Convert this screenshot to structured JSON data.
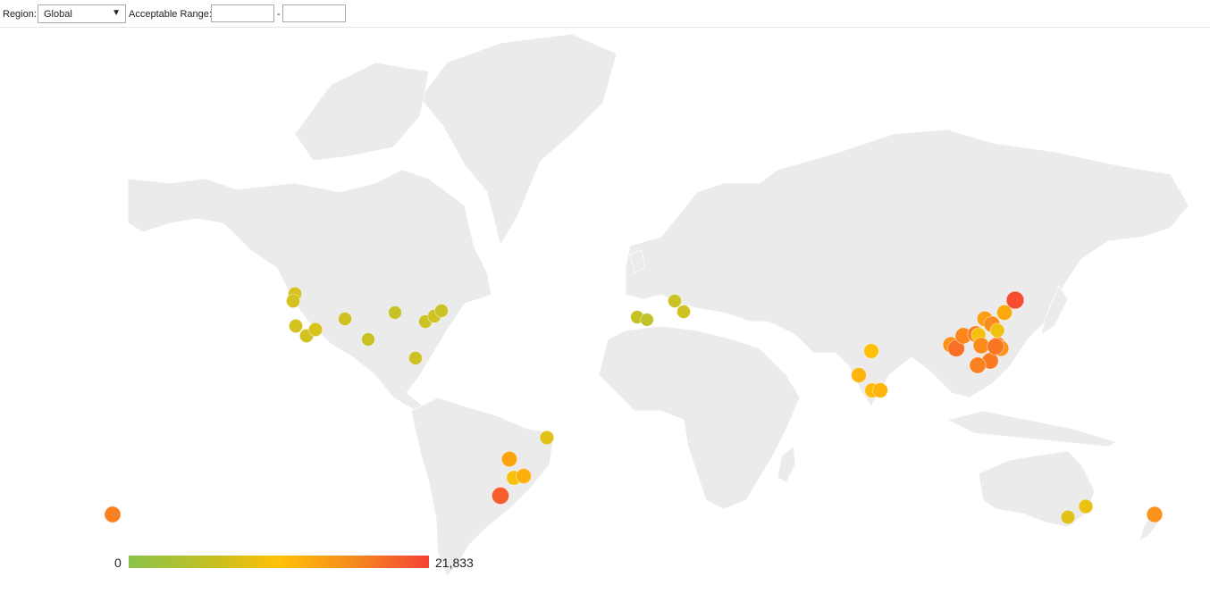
{
  "toolbar": {
    "region_label": "Region:",
    "region_value": "Global",
    "range_label": "Acceptable Range:",
    "range_separator": "-",
    "range_min": "",
    "range_max": ""
  },
  "legend": {
    "min_label": "0",
    "max_label": "21,833",
    "min": 0,
    "max": 21833,
    "colors": [
      "#8bc34a",
      "#ffc107",
      "#f44336"
    ]
  },
  "land_color": "#ebebeb",
  "border_color": "#ffffff",
  "markers": [
    {
      "region": "Hawaii",
      "value": 16500
    },
    {
      "region": "Seattle",
      "value": 7000
    },
    {
      "region": "Portland",
      "value": 6800
    },
    {
      "region": "San Francisco",
      "value": 6900
    },
    {
      "region": "Los Angeles",
      "value": 6600
    },
    {
      "region": "Arizona",
      "value": 7200
    },
    {
      "region": "Denver",
      "value": 6300
    },
    {
      "region": "Dallas",
      "value": 5800
    },
    {
      "region": "Chicago",
      "value": 5600
    },
    {
      "region": "Ashburn",
      "value": 6200
    },
    {
      "region": "New Jersey",
      "value": 6400
    },
    {
      "region": "New York",
      "value": 6000
    },
    {
      "region": "Miami",
      "value": 6100
    },
    {
      "region": "Brazil North",
      "value": 8000
    },
    {
      "region": "Brazil Central",
      "value": 13500
    },
    {
      "region": "Brazil West",
      "value": 10000
    },
    {
      "region": "Brazil South",
      "value": 12500
    },
    {
      "region": "Sao Paulo",
      "value": 19500
    },
    {
      "region": "Madrid",
      "value": 5500
    },
    {
      "region": "Barcelona",
      "value": 5000
    },
    {
      "region": "Frankfurt",
      "value": 6000
    },
    {
      "region": "Milan",
      "value": 6500
    },
    {
      "region": "Mumbai",
      "value": 12000
    },
    {
      "region": "Pune",
      "value": 11500
    },
    {
      "region": "Chennai",
      "value": 12000
    },
    {
      "region": "Hyderabad",
      "value": 11000
    },
    {
      "region": "China West",
      "value": 15000
    },
    {
      "region": "Chengdu",
      "value": 18000
    },
    {
      "region": "Chongqing",
      "value": 16000
    },
    {
      "region": "Xian",
      "value": 17000
    },
    {
      "region": "Beijing",
      "value": 14000
    },
    {
      "region": "Tianjin",
      "value": 15500
    },
    {
      "region": "Wuhan",
      "value": 10000
    },
    {
      "region": "Nanjing",
      "value": 16000
    },
    {
      "region": "Shanghai",
      "value": 15000
    },
    {
      "region": "Qingdao",
      "value": 9500
    },
    {
      "region": "Hangzhou",
      "value": 17000
    },
    {
      "region": "Fuzhou",
      "value": 16500
    },
    {
      "region": "Guangzhou",
      "value": 15500
    },
    {
      "region": "Shenzhen",
      "value": 17500
    },
    {
      "region": "Shenyang",
      "value": 13000
    },
    {
      "region": "Harbin",
      "value": 21000
    },
    {
      "region": "Sydney",
      "value": 9000
    },
    {
      "region": "Melbourne",
      "value": 8000
    },
    {
      "region": "Auckland",
      "value": 15000
    }
  ]
}
